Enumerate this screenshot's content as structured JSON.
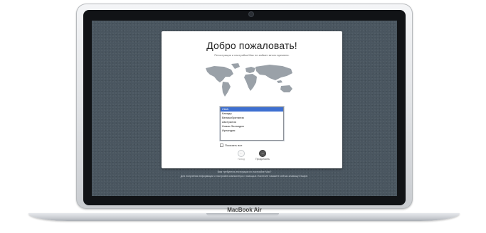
{
  "window": {
    "title": "Добро пожаловать!",
    "subtitle": "Регистрация и настройка Mac не займет много времени."
  },
  "country_list": {
    "items": [
      "США",
      "Канада",
      "Великобритания",
      "Австралия",
      "Новая Зеландия",
      "Ирландия"
    ],
    "selected_index": 0
  },
  "show_all": {
    "label": "Показать все",
    "checked": false
  },
  "buttons": {
    "back_label": "Назад",
    "next_label": "Продолжить"
  },
  "help": {
    "line1": "Вам требуются инструкции по настройке Mac?",
    "line2": "Для получения информации о настройке компьютера с помощью VoiceOver нажмите сейчас клавишу Escape."
  },
  "device": {
    "brand_label": "MacBook Air"
  },
  "icons": {
    "map": "world-map-icon",
    "back": "back-arrow-icon",
    "next": "next-arrow-icon"
  },
  "colors": {
    "selection": "#3d6fd1",
    "desktop": "#4a5660"
  }
}
